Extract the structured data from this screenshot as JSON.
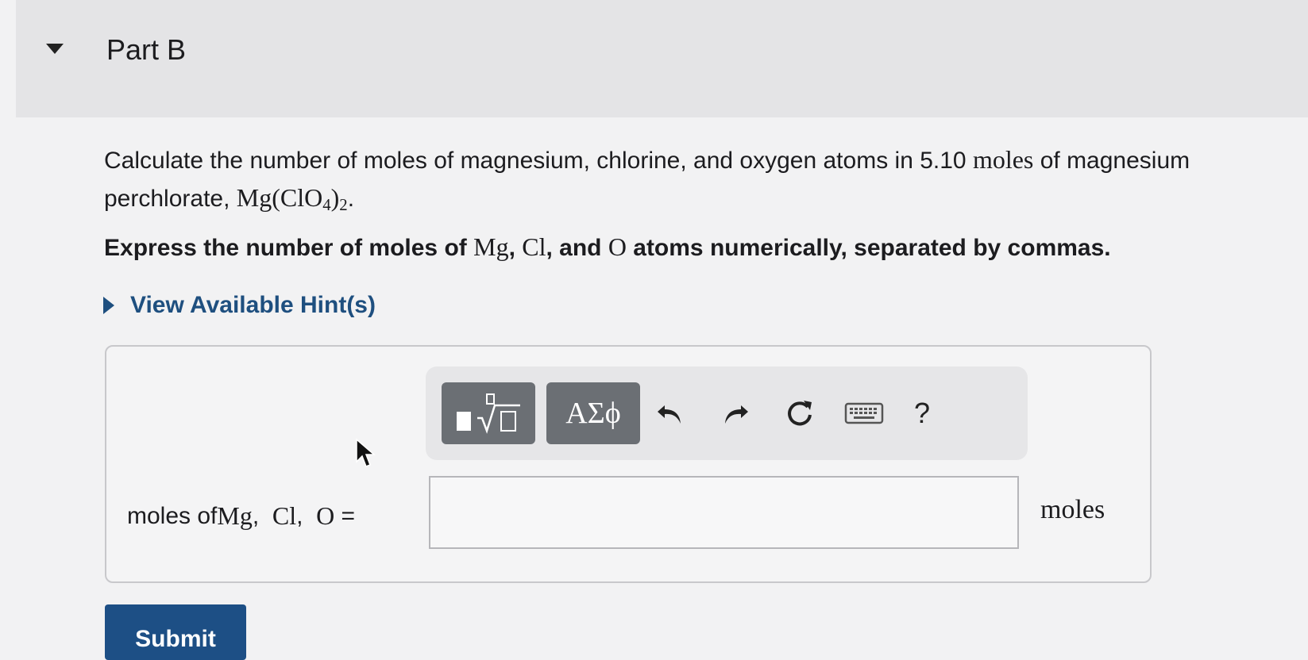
{
  "part": {
    "title": "Part B"
  },
  "question": {
    "text_before": "Calculate the number of moles of magnesium, chlorine, and oxygen atoms in 5.10 ",
    "unit": "moles",
    "text_middle": " of magnesium perchlorate, ",
    "formula_main": "Mg(ClO",
    "formula_sub4": "4",
    "formula_close": ")",
    "formula_sub2": "2",
    "text_end": "."
  },
  "instruction": {
    "text_before": "Express the number of moles of ",
    "mg": "Mg",
    "sep1": ", ",
    "cl": "Cl",
    "sep2": ", and ",
    "o": "O",
    "text_after": " atoms numerically, separated by commas."
  },
  "hints": {
    "label": "View Available Hint(s)"
  },
  "toolbar": {
    "greek_label": "ΑΣϕ",
    "help_label": "?",
    "icons": [
      "templates-icon",
      "undo-icon",
      "redo-icon",
      "reset-icon",
      "keyboard-icon",
      "help-icon"
    ]
  },
  "answer": {
    "label_prefix": "moles of ",
    "mg": "Mg",
    "sep1": ",  ",
    "cl": "Cl",
    "sep2": ",  ",
    "o": "O",
    "equals": " =",
    "value": "",
    "units": "moles"
  },
  "submit": {
    "label": "Submit"
  },
  "colors": {
    "link": "#1e4f7f",
    "submit_bg": "#1d4f85",
    "toolbar_button": "#6b6f74"
  }
}
